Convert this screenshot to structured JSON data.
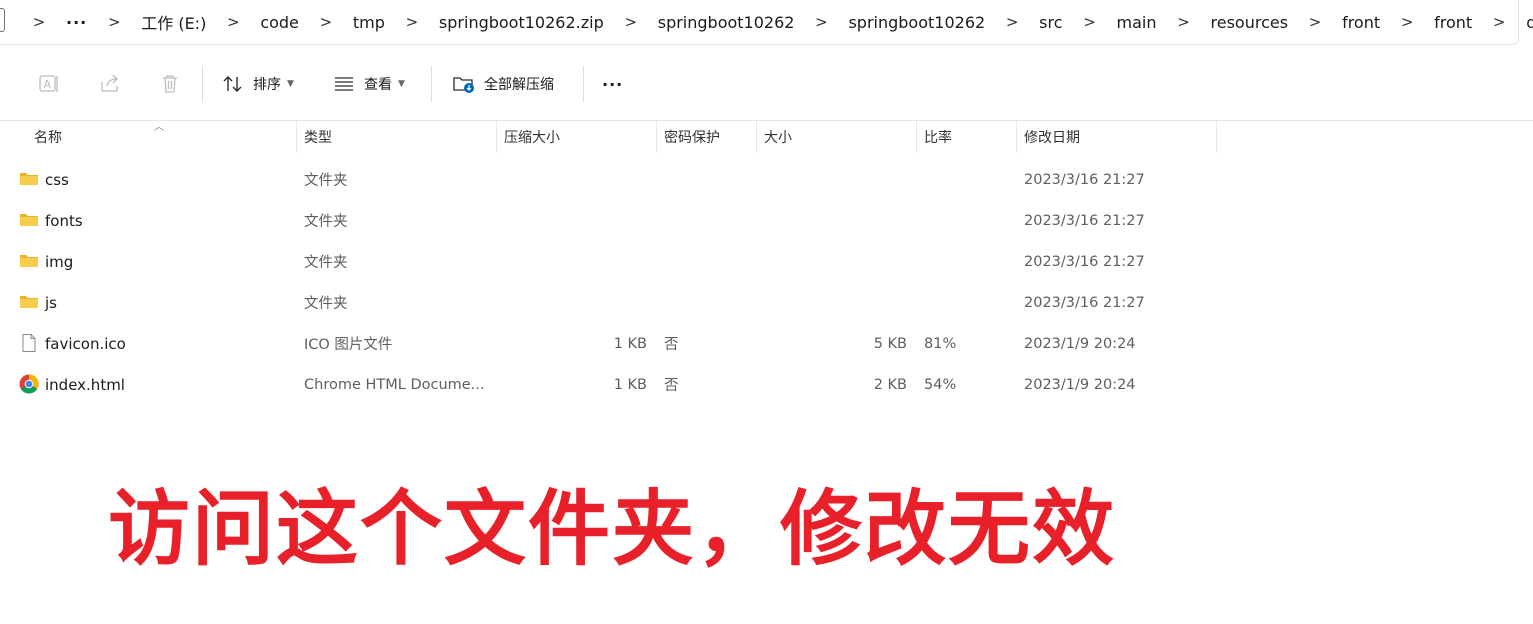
{
  "breadcrumb": {
    "more": "···",
    "items": [
      "工作 (E:)",
      "code",
      "tmp",
      "springboot10262.zip",
      "springboot10262",
      "springboot10262",
      "src",
      "main",
      "resources",
      "front",
      "front",
      "dist"
    ]
  },
  "toolbar": {
    "sort_label": "排序",
    "view_label": "查看",
    "extract_all_label": "全部解压缩",
    "more_label": "···"
  },
  "columns": {
    "name": "名称",
    "type": "类型",
    "compressed_size": "压缩大小",
    "password_protected": "密码保护",
    "size": "大小",
    "ratio": "比率",
    "date_modified": "修改日期"
  },
  "rows": [
    {
      "name": "css",
      "icon": "folder-icon",
      "type": "文件夹",
      "compressed": "",
      "password": "",
      "size": "",
      "ratio": "",
      "date": "2023/3/16 21:27"
    },
    {
      "name": "fonts",
      "icon": "folder-icon",
      "type": "文件夹",
      "compressed": "",
      "password": "",
      "size": "",
      "ratio": "",
      "date": "2023/3/16 21:27"
    },
    {
      "name": "img",
      "icon": "folder-icon",
      "type": "文件夹",
      "compressed": "",
      "password": "",
      "size": "",
      "ratio": "",
      "date": "2023/3/16 21:27"
    },
    {
      "name": "js",
      "icon": "folder-icon",
      "type": "文件夹",
      "compressed": "",
      "password": "",
      "size": "",
      "ratio": "",
      "date": "2023/3/16 21:27"
    },
    {
      "name": "favicon.ico",
      "icon": "file-icon",
      "type": "ICO 图片文件",
      "compressed": "1 KB",
      "password": "否",
      "size": "5 KB",
      "ratio": "81%",
      "date": "2023/1/9 20:24"
    },
    {
      "name": "index.html",
      "icon": "chrome-icon",
      "type": "Chrome HTML Docume...",
      "compressed": "1 KB",
      "password": "否",
      "size": "2 KB",
      "ratio": "54%",
      "date": "2023/1/9 20:24"
    }
  ],
  "annotation": "访问这个文件夹，修改无效",
  "colors": {
    "annotation": "#e8202a",
    "folder": "#f4c430",
    "accent": "#0067c0"
  }
}
